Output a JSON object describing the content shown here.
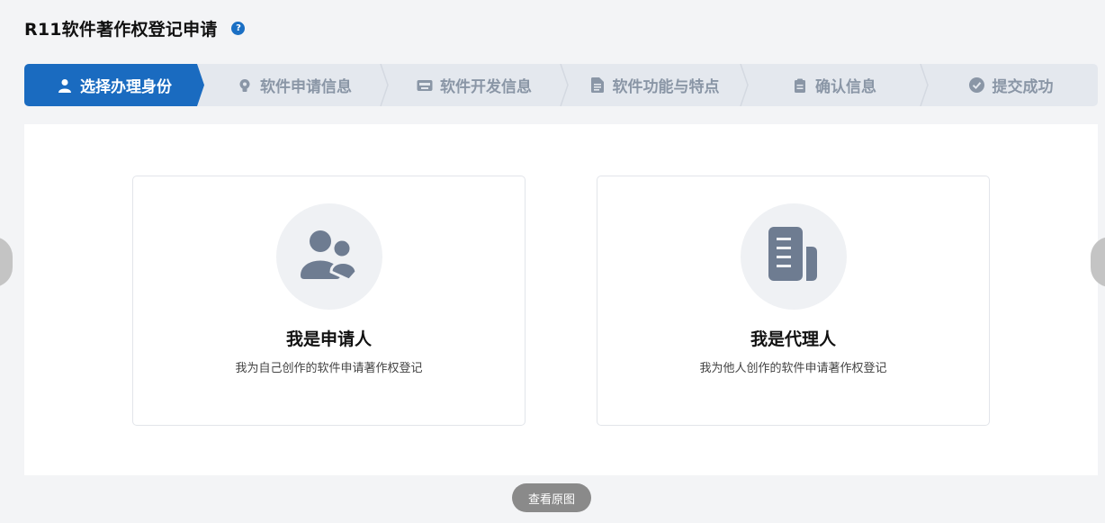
{
  "header": {
    "title": "R11软件著作权登记申请",
    "help_icon": "question-circle-icon",
    "help_glyph": "?"
  },
  "steps": [
    {
      "label": "选择办理身份",
      "icon": "user-icon",
      "active": true
    },
    {
      "label": "软件申请信息",
      "icon": "lightbulb-icon",
      "active": false
    },
    {
      "label": "软件开发信息",
      "icon": "keyboard-icon",
      "active": false
    },
    {
      "label": "软件功能与特点",
      "icon": "document-icon",
      "active": false
    },
    {
      "label": "确认信息",
      "icon": "clipboard-icon",
      "active": false
    },
    {
      "label": "提交成功",
      "icon": "check-circle-icon",
      "active": false
    }
  ],
  "cards": [
    {
      "title": "我是申请人",
      "desc": "我为自己创作的软件申请著作权登记",
      "icon": "users-icon"
    },
    {
      "title": "我是代理人",
      "desc": "我为他人创作的软件申请著作权登记",
      "icon": "file-icon"
    }
  ],
  "footer": {
    "view_original_label": "查看原图"
  },
  "colors": {
    "accent": "#1a6bc0",
    "step_inactive_text": "#8a96a6",
    "icon_gray": "#6e7c91",
    "background": "#f3f4f6"
  }
}
